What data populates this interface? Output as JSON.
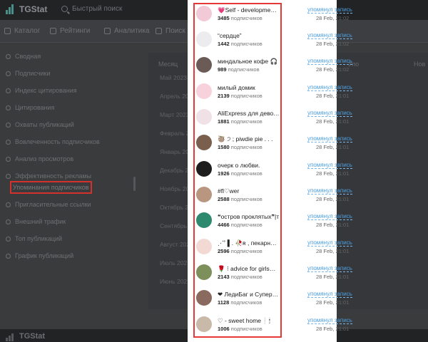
{
  "app": {
    "name": "TGStat",
    "search_placeholder": "Быстрый поиск"
  },
  "nav": [
    "Каталог",
    "Рейтинги",
    "Аналитика",
    "Поиск по"
  ],
  "sidebar": [
    "Сводная",
    "Подписчики",
    "Индекс цитирования",
    "Цитирования",
    "Охваты публикаций",
    "Вовлеченность подписчиков",
    "Анализ просмотров",
    "Эффективность рекламы",
    "Упоминания подписчиков",
    "Пригласительные ссылки",
    "Внешний трафик",
    "Топ публикаций",
    "График публикаций"
  ],
  "sidebar_active_index": 8,
  "table": {
    "col_month": "Месяц",
    "col_right": "Упо",
    "col_far": "Нов",
    "months": [
      "Май 2023",
      "Апрель 2023",
      "Март 2023",
      "Февраль 2023",
      "Январь 2023",
      "Декабрь 2022",
      "Ноябрь 2022",
      "Октябрь 2022",
      "Сентябрь 2022",
      "Август 2022",
      "Июль 2022",
      "Июнь 2022"
    ]
  },
  "mentions": [
    {
      "title": "💗Self - development💗",
      "count": "3485",
      "suffix": "подписчиков",
      "action": "упомянул запись",
      "date": "28 Feb, 21:02",
      "avatar_color": "#f2c9d6"
    },
    {
      "title": "“сердце”",
      "count": "1442",
      "suffix": "подписчиков",
      "action": "упомянул запись",
      "date": "28 Feb, 21:02",
      "avatar_color": "#ecebed"
    },
    {
      "title": "миндальное кофе 🎧",
      "count": "989",
      "suffix": "подписчиков",
      "action": "упомянул запись",
      "date": "28 Feb, 21:02",
      "avatar_color": "#6b5b56"
    },
    {
      "title": "милый домик",
      "count": "2139",
      "suffix": "подписчиков",
      "action": "упомянул запись",
      "date": "28 Feb, 21:01",
      "avatar_color": "#f7d2dc"
    },
    {
      "title": "AliExpress для девочек 🎀",
      "count": "1881",
      "suffix": "подписчиков",
      "action": "упомянул запись",
      "date": "28 Feb, 21:01",
      "avatar_color": "#f0e1e6"
    },
    {
      "title": "🦥 ੭ ; piwdie pie . . .",
      "count": "1580",
      "suffix": "подписчиков",
      "action": "упомянул запись",
      "date": "28 Feb, 21:01",
      "avatar_color": "#7a5f4f"
    },
    {
      "title": "очерк о любви.",
      "count": "1926",
      "suffix": "подписчиков",
      "action": "упомянул запись",
      "date": "28 Feb, 21:01",
      "avatar_color": "#1e1e1e"
    },
    {
      "title": "#fl♡wer",
      "count": "2588",
      "suffix": "подписчиков",
      "action": "упомянул запись",
      "date": "28 Feb, 21:01",
      "avatar_color": "#b89680"
    },
    {
      "title": "❝остров проклятых❞|т",
      "count": "4466",
      "suffix": "подписчиков",
      "action": "упомянул запись",
      "date": "28 Feb, 21:01",
      "avatar_color": "#2e8a6e"
    },
    {
      "title": "⋰˚ ▌. 🥀ʀ , пекарня на .",
      "count": "2596",
      "suffix": "подписчиков",
      "action": "упомянул запись",
      "date": "28 Feb, 21:01",
      "avatar_color": "#f3d9d4"
    },
    {
      "title": "🌹 ⁝ advice for girls🌈🥀",
      "count": "2143",
      "suffix": "подписчиков",
      "action": "упомянул запись",
      "date": "28 Feb, 21:01",
      "avatar_color": "#7d8f5a"
    },
    {
      "title": "❤ ЛедиБаг и СуперКот",
      "count": "1128",
      "suffix": "подписчиков",
      "action": "упомянул запись",
      "date": "28 Feb, 21:01",
      "avatar_color": "#8a6a5e"
    },
    {
      "title": "♡ - sweet home❕🕯",
      "count": "1006",
      "suffix": "подписчиков",
      "action": "упомянул запись",
      "date": "28 Feb, 21:01",
      "avatar_color": "#c9b9a8"
    }
  ]
}
